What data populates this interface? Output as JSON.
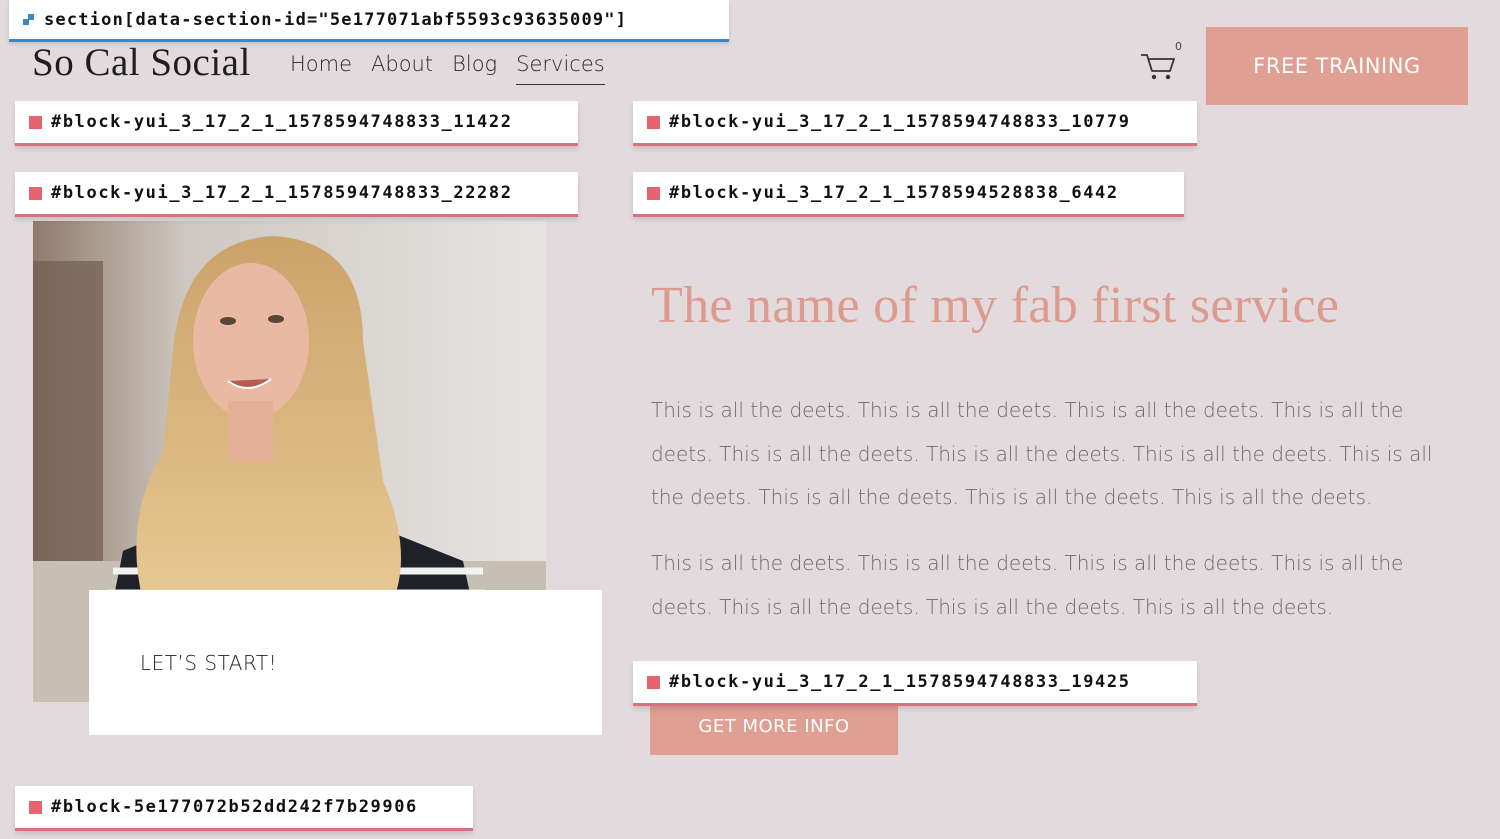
{
  "header": {
    "logo": "So Cal Social",
    "nav": [
      "Home",
      "About",
      "Blog",
      "Services"
    ],
    "active_nav": "Services",
    "cart_count": "0",
    "cta": "FREE TRAINING"
  },
  "editor_overlay": {
    "section_tag": "section[data-section-id=\"5e177071abf5593c93635009\"]",
    "block_tags": [
      "#block-yui_3_17_2_1_1578594748833_11422",
      "#block-yui_3_17_2_1_1578594748833_10779",
      "#block-yui_3_17_2_1_1578594748833_22282",
      "#block-yui_3_17_2_1_1578594528838_6442",
      "#block-yui_3_17_2_1_1578594748833_19425",
      "#block-5e177072b52dd242f7b29906"
    ]
  },
  "main": {
    "start_label": "LET’S START!",
    "headline": "The name of my fab first service",
    "paragraphs": [
      "This is all the deets. This is all the deets. This is all the deets. This is all the deets. This is all the deets. This is all the deets. This is all the deets. This is all the deets. This is all the deets. This is all the deets. This is all the deets.",
      "This is all the deets. This is all the deets. This is all the deets. This is all the deets. This is all the deets. This is all the deets. This is all the deets."
    ],
    "button": "GET MORE INFO"
  },
  "colors": {
    "background": "#e2dadc",
    "accent": "#df9f93",
    "headline": "#dd9b90",
    "block_outline": "#d9707d",
    "section_outline": "#3b88c9"
  }
}
